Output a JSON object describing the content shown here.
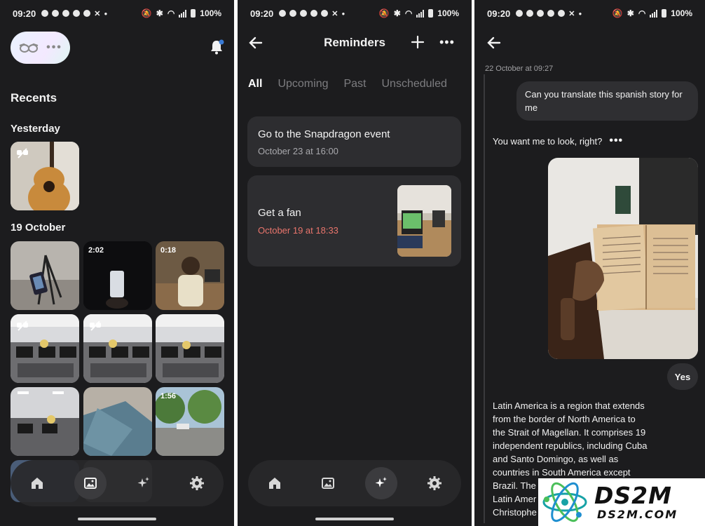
{
  "status_bar": {
    "time": "09:20",
    "battery": "100%"
  },
  "colors": {
    "background": "#1c1c1e",
    "card": "#2d2d30",
    "accent_red": "#e9756c",
    "notification_dot": "#3a7bd5"
  },
  "panel_home": {
    "section_title": "Recents",
    "groups": [
      {
        "label": "Yesterday",
        "items": [
          {
            "type": "photo",
            "subject": "guitar",
            "duration": ""
          }
        ]
      },
      {
        "label": "19 October",
        "items": [
          {
            "type": "photo",
            "subject": "tripod-hand",
            "duration": ""
          },
          {
            "type": "video",
            "subject": "phone-dark",
            "duration": "2:02"
          },
          {
            "type": "video",
            "subject": "person-room",
            "duration": "0:18"
          },
          {
            "type": "photo",
            "subject": "office-wide",
            "duration": ""
          },
          {
            "type": "photo",
            "subject": "office-wide",
            "duration": ""
          },
          {
            "type": "photo",
            "subject": "office-wide",
            "duration": ""
          },
          {
            "type": "photo",
            "subject": "office-lights",
            "duration": ""
          },
          {
            "type": "photo",
            "subject": "jeans-floor",
            "duration": ""
          },
          {
            "type": "video",
            "subject": "street",
            "duration": "1:56"
          }
        ]
      }
    ],
    "nav": [
      {
        "icon": "home-icon"
      },
      {
        "icon": "gallery-icon",
        "active": true
      },
      {
        "icon": "sparkle-icon"
      },
      {
        "icon": "gear-icon"
      }
    ]
  },
  "panel_reminders": {
    "title": "Reminders",
    "tabs": [
      "All",
      "Upcoming",
      "Past",
      "Unscheduled"
    ],
    "active_tab": "All",
    "cards": [
      {
        "title": "Go to the Snapdragon event",
        "subtitle": "October 23 at 16:00"
      },
      {
        "title": "Get a fan",
        "subtitle": "October 19 at 18:33"
      }
    ],
    "nav": [
      {
        "icon": "home-icon"
      },
      {
        "icon": "gallery-icon"
      },
      {
        "icon": "sparkle-icon",
        "active": true
      },
      {
        "icon": "gear-icon"
      }
    ]
  },
  "panel_chat": {
    "timestamp": "22 October at 09:27",
    "user_message": "Can you translate this spanish story for me",
    "assistant_prompt": "You want me to look, right?",
    "reply_yes": "Yes",
    "assistant_text_lines": [
      "Latin America is a region that extends",
      "from the border of North America to",
      "the Strait of Magellan. It comprises 19",
      "independent republics, including Cuba",
      "and Santo Domingo, as well as",
      "countries in South America except",
      "Brazil. The",
      "Latin Amer",
      "Christophe"
    ]
  },
  "watermark": {
    "big": "DS2M",
    "small": "DS2M.COM"
  }
}
